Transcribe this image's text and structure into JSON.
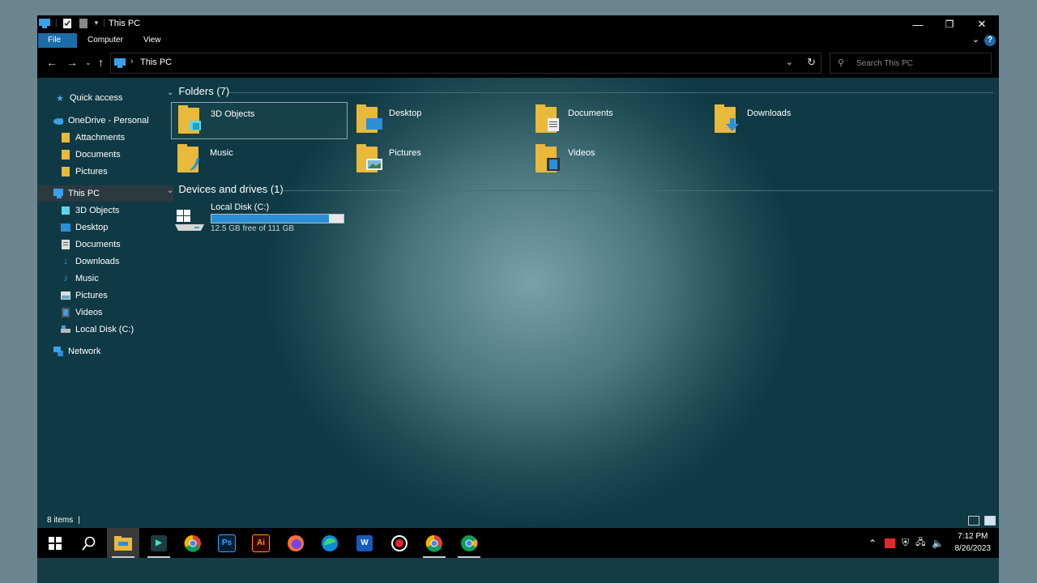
{
  "window": {
    "title": "This PC",
    "min_label": "—",
    "max_label": "❐",
    "close_label": "✕"
  },
  "ribbon": {
    "tabs": [
      "File",
      "Computer",
      "View"
    ],
    "help_label": "?",
    "expand_label": "⌄"
  },
  "address": {
    "separator": "›",
    "path": "This PC",
    "dropdown_label": "⌄",
    "refresh_label": "↻"
  },
  "search": {
    "placeholder": "Search This PC"
  },
  "nav": {
    "quick_access": "Quick access",
    "onedrive": "OneDrive - Personal",
    "onedrive_items": [
      "Attachments",
      "Documents",
      "Pictures"
    ],
    "this_pc": "This PC",
    "this_pc_items": [
      "3D Objects",
      "Desktop",
      "Documents",
      "Downloads",
      "Music",
      "Pictures",
      "Videos",
      "Local Disk (C:)"
    ],
    "network": "Network"
  },
  "content": {
    "folders_header": "Folders (7)",
    "folders": [
      "3D Objects",
      "Desktop",
      "Documents",
      "Downloads",
      "Music",
      "Pictures",
      "Videos"
    ],
    "devices_header": "Devices and drives (1)",
    "drive": {
      "name": "Local Disk (C:)",
      "free_text": "12.5 GB free of 111 GB",
      "used_fraction": 0.887
    }
  },
  "status": {
    "items_text": "8 items",
    "cursor": "|"
  },
  "taskbar": {
    "apps": [
      "start-icon",
      "search-icon",
      "file-explorer-icon",
      "app-icon",
      "chrome-icon",
      "photoshop-icon",
      "illustrator-icon",
      "firefox-icon",
      "edge-icon",
      "word-icon",
      "recorder-icon",
      "chrome-icon",
      "chrome-icon"
    ],
    "ps_label": "Ps",
    "ai_label": "Ai",
    "word_label": "W",
    "clock_time": "7:12 PM",
    "clock_date": "8/26/2023"
  },
  "colors": {
    "accent": "#1b6ca8",
    "folder": "#e8b93a",
    "drive_bar": "#2b8fd8"
  }
}
